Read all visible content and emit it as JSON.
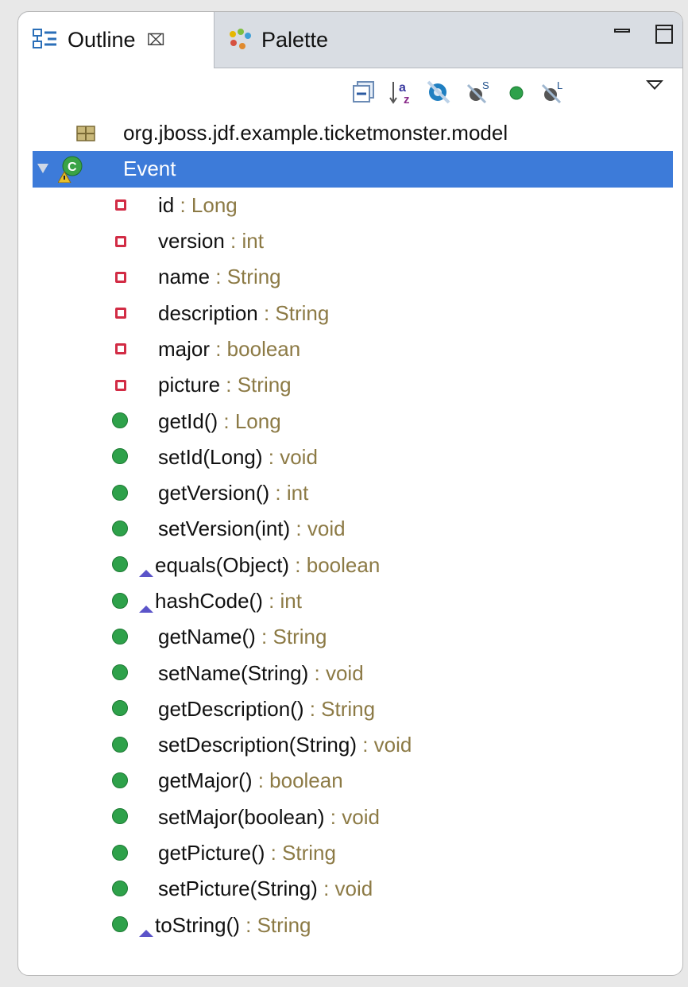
{
  "tabs": [
    {
      "label": "Outline",
      "icon": "outline-icon",
      "close": "⌧"
    },
    {
      "label": "Palette",
      "icon": "palette-icon"
    }
  ],
  "toolbar": {
    "icons": [
      "collapse-all-icon",
      "sort-alpha-icon",
      "hide-fields-icon",
      "hide-static-icon",
      "hide-non-public-icon",
      "hide-local-types-icon",
      "view-menu-icon"
    ]
  },
  "tree": {
    "package": "org.jboss.jdf.example.ticketmonster.model",
    "class": "Event",
    "members": [
      {
        "kind": "field",
        "name": "id",
        "type": " : Long"
      },
      {
        "kind": "field",
        "name": "version",
        "type": " : int"
      },
      {
        "kind": "field",
        "name": "name",
        "type": " : String"
      },
      {
        "kind": "field",
        "name": "description",
        "type": " : String"
      },
      {
        "kind": "field",
        "name": "major",
        "type": " : boolean"
      },
      {
        "kind": "field",
        "name": "picture",
        "type": " : String"
      },
      {
        "kind": "method",
        "name": "getId()",
        "type": " : Long"
      },
      {
        "kind": "method",
        "name": "setId(Long)",
        "type": " : void"
      },
      {
        "kind": "method",
        "name": "getVersion()",
        "type": " : int"
      },
      {
        "kind": "method",
        "name": "setVersion(int)",
        "type": " : void"
      },
      {
        "kind": "method-override",
        "name": "equals(Object)",
        "type": " : boolean"
      },
      {
        "kind": "method-override",
        "name": "hashCode()",
        "type": " : int"
      },
      {
        "kind": "method",
        "name": "getName()",
        "type": " : String"
      },
      {
        "kind": "method",
        "name": "setName(String)",
        "type": " : void"
      },
      {
        "kind": "method",
        "name": "getDescription()",
        "type": " : String"
      },
      {
        "kind": "method",
        "name": "setDescription(String)",
        "type": " : void"
      },
      {
        "kind": "method",
        "name": "getMajor()",
        "type": " : boolean"
      },
      {
        "kind": "method",
        "name": "setMajor(boolean)",
        "type": " : void"
      },
      {
        "kind": "method",
        "name": "getPicture()",
        "type": " : String"
      },
      {
        "kind": "method",
        "name": "setPicture(String)",
        "type": " : void"
      },
      {
        "kind": "method-override",
        "name": "toString()",
        "type": " : String"
      }
    ]
  },
  "colors": {
    "selection": "#3d7bd9",
    "type_text": "#8c7a45",
    "field_icon": "#d22c45",
    "method_icon": "#2ea14a"
  }
}
